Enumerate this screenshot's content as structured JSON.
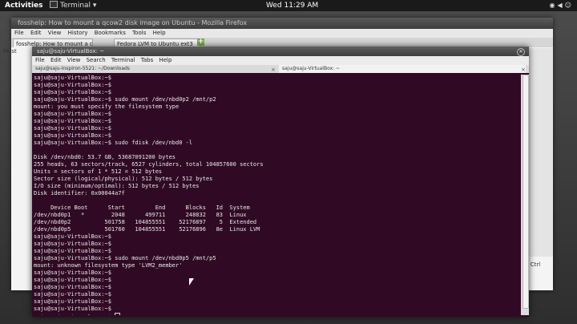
{
  "topbar": {
    "activities": "Activities",
    "app_name": "Terminal",
    "clock": "Wed 11:29 AM",
    "tray_icons": [
      "wifi-icon",
      "volume-icon",
      "user-icon"
    ]
  },
  "firefox": {
    "title": "fosshelp: How to mount a qcow2 disk image on Ubuntu - Mozilla Firefox",
    "menu": [
      "File",
      "Edit",
      "View",
      "History",
      "Bookmarks",
      "Tools",
      "Help"
    ],
    "tabs": [
      "fosshelp: How to mount a q...",
      "Fedora LVM to Ubuntu ext3"
    ],
    "bookmark_text": "Most",
    "side_text": "ight Ctrl"
  },
  "terminal": {
    "title": "saju@saju-VirtualBox: ~",
    "menu": [
      "File",
      "Edit",
      "View",
      "Search",
      "Terminal",
      "Tabs",
      "Help"
    ],
    "tabs": [
      "saju@saju-Inspiron-5521: ~/Downloads",
      "saju@saju-VirtualBox: ~"
    ],
    "lines": [
      "saju@saju-VirtualBox:~$",
      "saju@saju-VirtualBox:~$",
      "saju@saju-VirtualBox:~$",
      "saju@saju-VirtualBox:~$ sudo mount /dev/nbd0p2 /mnt/p2",
      "mount: you must specify the filesystem type",
      "saju@saju-VirtualBox:~$",
      "saju@saju-VirtualBox:~$",
      "saju@saju-VirtualBox:~$",
      "saju@saju-VirtualBox:~$",
      "saju@saju-VirtualBox:~$ sudo fdisk /dev/nbd0 -l",
      "",
      "Disk /dev/nbd0: 53.7 GB, 53687091200 bytes",
      "255 heads, 63 sectors/track, 6527 cylinders, total 104857600 sectors",
      "Units = sectors of 1 * 512 = 512 bytes",
      "Sector size (logical/physical): 512 bytes / 512 bytes",
      "I/O size (minimum/optimal): 512 bytes / 512 bytes",
      "Disk identifier: 0x00044a7f",
      "",
      "     Device Boot      Start         End      Blocks   Id  System",
      "/dev/nbd0p1   *        2048      499711      248832   83  Linux",
      "/dev/nbd0p2          501758   104855551    52176897    5  Extended",
      "/dev/nbd0p5          501760   104855551    52176896   8e  Linux LVM",
      "saju@saju-VirtualBox:~$",
      "saju@saju-VirtualBox:~$",
      "saju@saju-VirtualBox:~$",
      "saju@saju-VirtualBox:~$ sudo mount /dev/nbd0p5 /mnt/p5",
      "mount: unknown filesystem type 'LVM2_member'",
      "saju@saju-VirtualBox:~$",
      "saju@saju-VirtualBox:~$",
      "saju@saju-VirtualBox:~$",
      "saju@saju-VirtualBox:~$",
      "saju@saju-VirtualBox:~$",
      "saju@saju-VirtualBox:~$",
      "saju@saju-VirtualBox:~$"
    ]
  }
}
